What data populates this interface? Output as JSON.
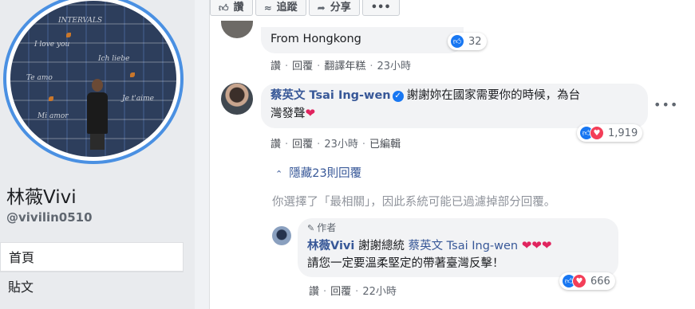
{
  "profile": {
    "name": "林薇Vivi",
    "handle": "@vivilin0510",
    "photo_words": [
      "INTERVALS",
      "I love you",
      "Ich liebe",
      "Te amo",
      "Je t'aime",
      "Mi amor"
    ]
  },
  "nav": {
    "items": [
      {
        "label": "首頁"
      },
      {
        "label": "貼文"
      }
    ]
  },
  "actions": {
    "like": "讚",
    "follow": "追蹤",
    "share": "分享",
    "more": "•••"
  },
  "colors": {
    "accent": "#385898",
    "verified": "#1877f2",
    "love": "#f33e58",
    "ring": "#4a90e2"
  },
  "comment1": {
    "text": "From Hongkong",
    "like": "讚",
    "reply": "回覆",
    "translate": "翻譯年糕",
    "time": "23小時",
    "reaction_count": "32"
  },
  "comment2": {
    "author": "蔡英文 Tsai Ing-wen",
    "text_line1": "謝謝妳在國家需要你的時候，為台",
    "text_line2": "灣發聲",
    "like": "讚",
    "reply": "回覆",
    "time": "23小時",
    "edited": "已編輯",
    "reaction_count": "1,919",
    "more": "•••"
  },
  "replies": {
    "hide": "隱藏23則回覆",
    "filter_note": "你選擇了「最相關」，因此系統可能已過濾掉部分回覆。"
  },
  "reply1": {
    "badge": "作者",
    "author": "林薇Vivi",
    "text_pre": "謝謝總統",
    "mention": "蔡英文 Tsai Ing-wen",
    "text_line2": "請您一定要溫柔堅定的帶著臺灣反擊！",
    "like": "讚",
    "reply": "回覆",
    "time": "22小時",
    "reaction_count": "666"
  },
  "icons": [
    "thumbs-up-icon",
    "rss-icon",
    "share-arrow-icon",
    "more-icon",
    "verified-icon",
    "heart-icon",
    "chevron-up-icon",
    "pencil-icon",
    "love-reaction-icon",
    "like-reaction-icon"
  ]
}
